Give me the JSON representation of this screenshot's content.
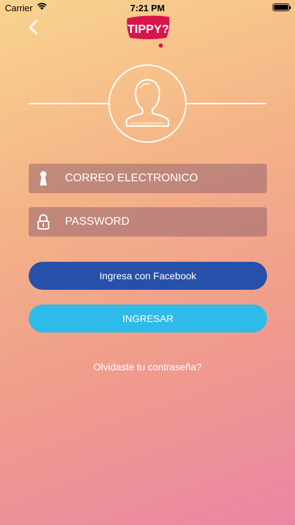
{
  "status_bar": {
    "carrier": "Carrier",
    "time": "7:21 PM"
  },
  "header": {
    "back_icon": "chevron-left-icon",
    "logo_text": "TIPPY?"
  },
  "avatar": {
    "icon": "user-silhouette-icon"
  },
  "form": {
    "email": {
      "placeholder": "CORREO ELECTRONICO",
      "value": "",
      "icon": "keyhole-icon"
    },
    "password": {
      "placeholder": "PASSWORD",
      "value": "",
      "icon": "padlock-icon"
    }
  },
  "buttons": {
    "facebook_label": "Ingresa con Facebook",
    "login_label": "INGRESAR"
  },
  "links": {
    "forgot_password": "Olvidaste tu contraseña?"
  },
  "colors": {
    "facebook_button": "#2750aa",
    "login_button": "#2fbbea",
    "logo_red": "#d8154a",
    "field_bg": "rgba(150,100,110,0.55)"
  }
}
